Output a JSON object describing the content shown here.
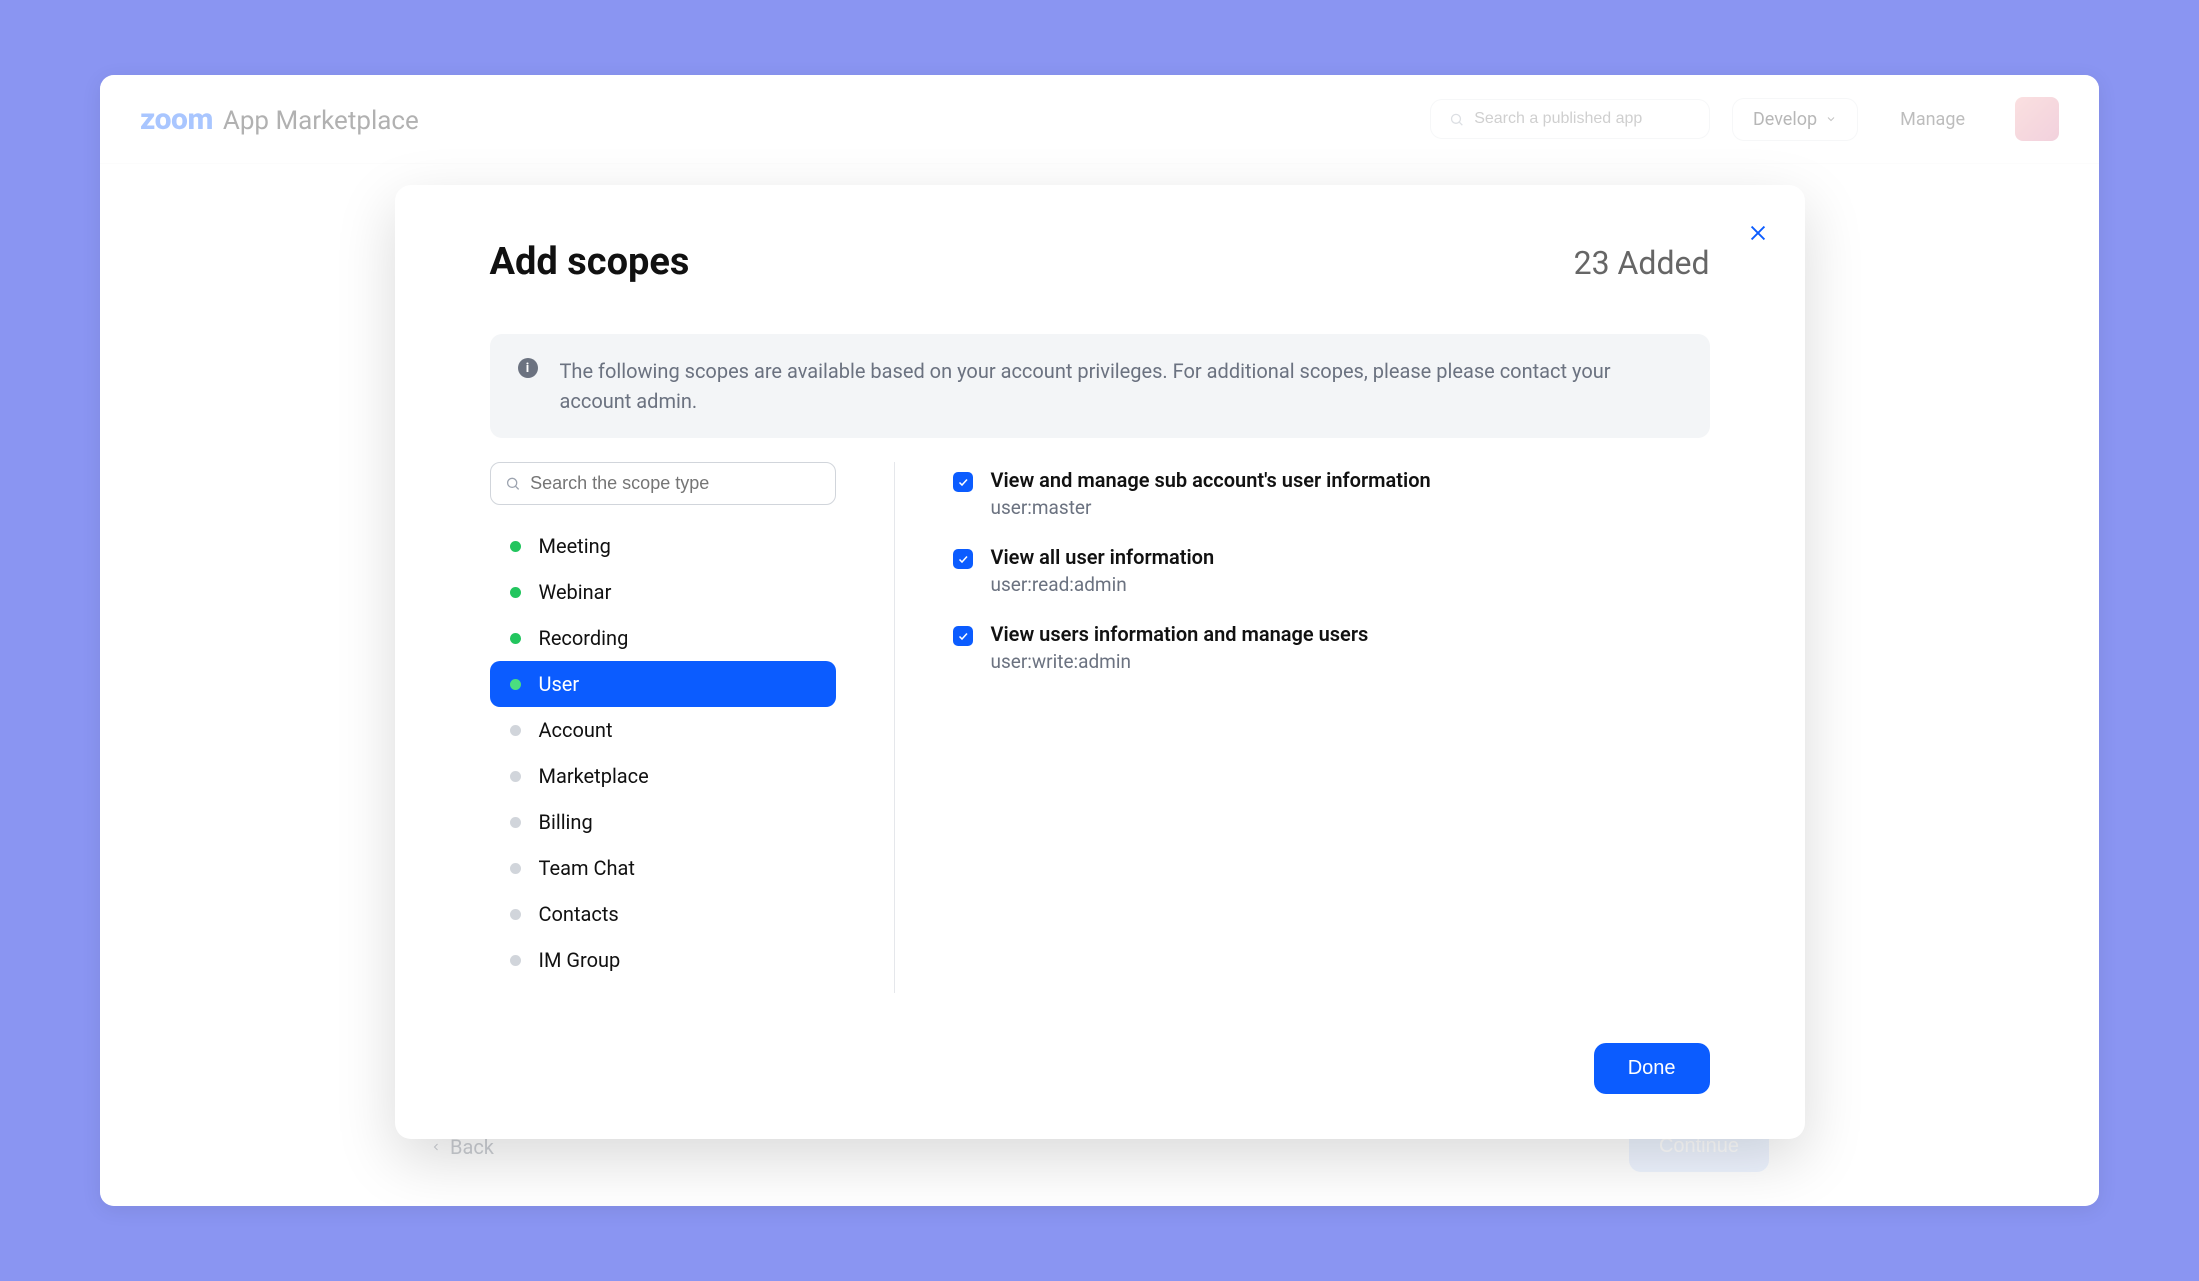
{
  "header": {
    "logo_brand": "zoom",
    "logo_text": "App Marketplace",
    "search_placeholder": "Search a published app",
    "develop_label": "Develop",
    "manage_label": "Manage"
  },
  "page": {
    "back_label": "Back",
    "continue_label": "Continue"
  },
  "modal": {
    "title": "Add scopes",
    "added_count_label": "23 Added",
    "info_text": "The following scopes are available based on your account privileges. For additional scopes, please please contact your account admin.",
    "scope_search_placeholder": "Search the scope type",
    "done_label": "Done",
    "categories": [
      {
        "label": "Meeting",
        "active_dot": true,
        "selected": false
      },
      {
        "label": "Webinar",
        "active_dot": true,
        "selected": false
      },
      {
        "label": "Recording",
        "active_dot": true,
        "selected": false
      },
      {
        "label": "User",
        "active_dot": true,
        "selected": true
      },
      {
        "label": "Account",
        "active_dot": false,
        "selected": false
      },
      {
        "label": "Marketplace",
        "active_dot": false,
        "selected": false
      },
      {
        "label": "Billing",
        "active_dot": false,
        "selected": false
      },
      {
        "label": "Team Chat",
        "active_dot": false,
        "selected": false
      },
      {
        "label": "Contacts",
        "active_dot": false,
        "selected": false
      },
      {
        "label": "IM Group",
        "active_dot": false,
        "selected": false
      }
    ],
    "scopes": [
      {
        "title": "View and manage sub account's user information",
        "id": "user:master",
        "checked": true
      },
      {
        "title": "View all user information",
        "id": "user:read:admin",
        "checked": true
      },
      {
        "title": "View users information and manage users",
        "id": "user:write:admin",
        "checked": true
      }
    ]
  }
}
